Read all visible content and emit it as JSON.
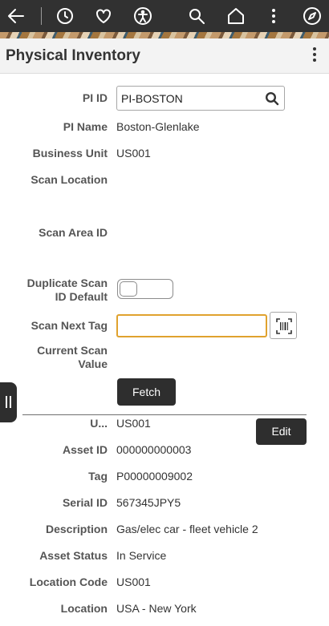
{
  "nav": {
    "icons": [
      "back-arrow-icon",
      "history-icon",
      "heart-icon",
      "accessibility-icon",
      "search-icon",
      "home-icon",
      "more-vertical-icon",
      "compass-icon"
    ]
  },
  "header": {
    "title": "Physical Inventory"
  },
  "form": {
    "pi_id_label": "PI ID",
    "pi_id_value": "PI-BOSTON",
    "pi_name_label": "PI Name",
    "pi_name_value": "Boston-Glenlake",
    "business_unit_label": "Business Unit",
    "business_unit_value": "US001",
    "scan_location_label": "Scan Location",
    "scan_area_label": "Scan Area ID",
    "duplicate_scan_label_line1": "Duplicate Scan",
    "duplicate_scan_label_line2": "ID Default",
    "duplicate_scan_toggle_on": false,
    "scan_next_tag_label": "Scan Next Tag",
    "scan_next_tag_value": "",
    "current_scan_label_line1": "Current Scan",
    "current_scan_label_line2": "Value",
    "fetch_label": "Fetch"
  },
  "asset": {
    "unit_label": "U...",
    "unit_value": "US001",
    "edit_label": "Edit",
    "asset_id_label": "Asset ID",
    "asset_id_value": "000000000003",
    "tag_label": "Tag",
    "tag_value": "P00000009002",
    "serial_id_label": "Serial ID",
    "serial_id_value": "567345JPY5",
    "description_label": "Description",
    "description_value": "Gas/elec car - fleet vehicle 2",
    "asset_status_label": "Asset Status",
    "asset_status_value": "In Service",
    "location_code_label": "Location Code",
    "location_code_value": "US001",
    "location_label": "Location",
    "location_value": "USA - New York"
  },
  "colors": {
    "topbar": "#313131",
    "focus_border": "#e0a22e",
    "button_dark": "#2e2e2e"
  }
}
